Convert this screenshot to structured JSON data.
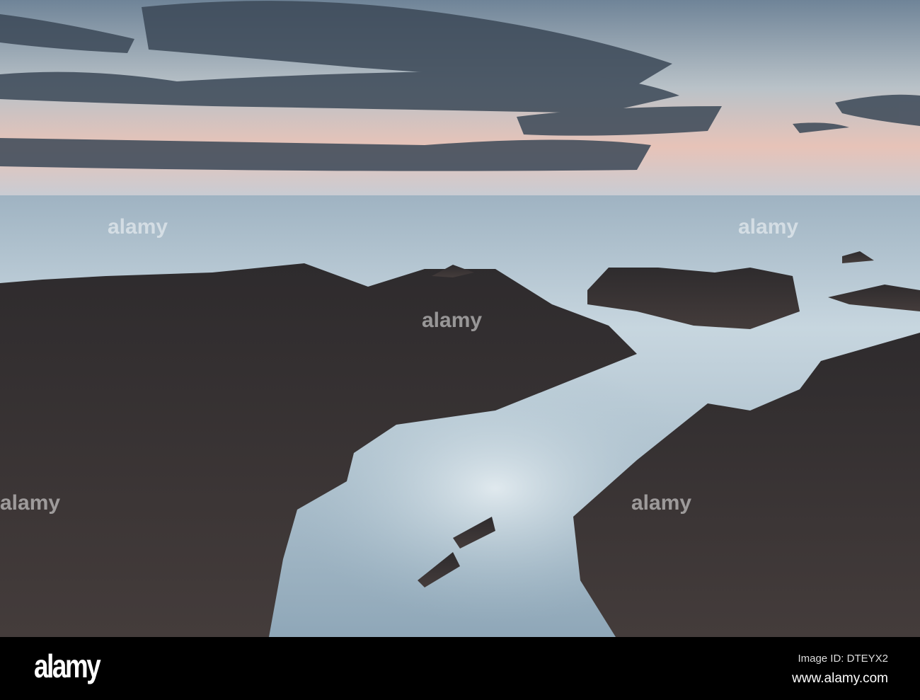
{
  "photo": {
    "subject": "rocky shoreline",
    "watermark_text": "alamy",
    "colors": {
      "sky_top": "#6f8498",
      "sky_glow": "#e7c3b8",
      "cloud": "#3b4857",
      "sea": "#9fb6c6",
      "rock": "#3a3434"
    }
  },
  "footer": {
    "logo": "alamy",
    "image_id": "Image ID: DTEYX2",
    "url": "www.alamy.com"
  }
}
